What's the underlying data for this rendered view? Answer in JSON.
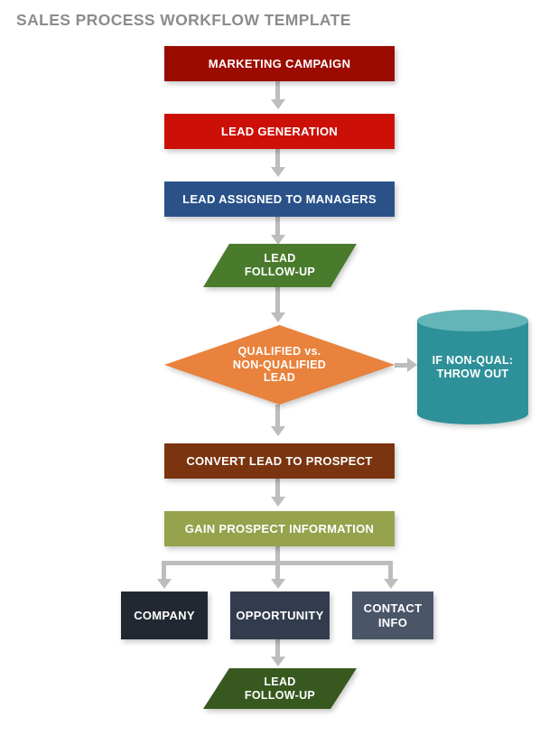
{
  "page": {
    "title": "SALES PROCESS WORKFLOW TEMPLATE",
    "background_color": "#FFFFFF",
    "title_color": "#8C8C8C",
    "connector_color": "#BDBDBD"
  },
  "nodes": {
    "marketing_campaign": {
      "label": "MARKETING CAMPAIGN",
      "shape": "rectangle",
      "color": "#9B0B00",
      "text_color": "#FFFFFF"
    },
    "lead_generation": {
      "label": "LEAD GENERATION",
      "shape": "rectangle",
      "color": "#CC1008",
      "text_color": "#FFFFFF"
    },
    "lead_assigned": {
      "label": "LEAD ASSIGNED TO MANAGERS",
      "shape": "rectangle",
      "color": "#2A5289",
      "text_color": "#FFFFFF"
    },
    "lead_followup_top": {
      "line1": "LEAD",
      "line2": "FOLLOW-UP",
      "shape": "parallelogram",
      "color": "#4A7B2D",
      "text_color": "#FFFFFF"
    },
    "qualified_decision": {
      "line1": "QUALIFIED vs.",
      "line2": "NON-QUALIFIED",
      "line3": "LEAD",
      "shape": "diamond",
      "color": "#E8823C",
      "text_color": "#FFFFFF"
    },
    "throw_out": {
      "line1": "IF NON-QUAL:",
      "line2": "THROW OUT",
      "shape": "cylinder",
      "color": "#2E9199",
      "top_color": "#63B5B7",
      "text_color": "#FFFFFF"
    },
    "convert_lead": {
      "label": "CONVERT LEAD TO PROSPECT",
      "shape": "rectangle",
      "color": "#7A3510",
      "text_color": "#FFFFFF"
    },
    "gain_prospect_info": {
      "label": "GAIN PROSPECT INFORMATION",
      "shape": "rectangle",
      "color": "#96A24C",
      "text_color": "#FFFFFF"
    },
    "company": {
      "label": "COMPANY",
      "shape": "rectangle",
      "color": "#222831",
      "text_color": "#FFFFFF"
    },
    "opportunity": {
      "label": "OPPORTUNITY",
      "shape": "rectangle",
      "color": "#323C4E",
      "text_color": "#FFFFFF"
    },
    "contact_info": {
      "line1": "CONTACT",
      "line2": "INFO",
      "shape": "rectangle",
      "color": "#4A5568",
      "text_color": "#FFFFFF"
    },
    "lead_followup_bottom": {
      "line1": "LEAD",
      "line2": "FOLLOW-UP",
      "shape": "parallelogram",
      "color": "#37591F",
      "text_color": "#FFFFFF"
    }
  },
  "flow_sequence": [
    "MARKETING CAMPAIGN",
    "LEAD GENERATION",
    "LEAD ASSIGNED TO MANAGERS",
    "LEAD FOLLOW-UP",
    "QUALIFIED vs. NON-QUALIFIED LEAD",
    "CONVERT LEAD TO PROSPECT",
    "GAIN PROSPECT INFORMATION",
    "COMPANY / OPPORTUNITY / CONTACT INFO",
    "LEAD FOLLOW-UP"
  ]
}
